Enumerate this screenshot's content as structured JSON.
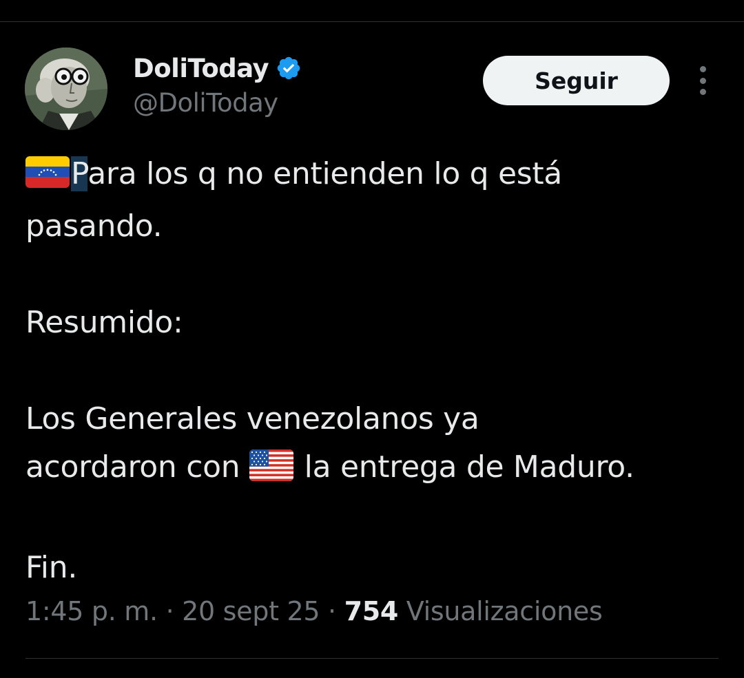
{
  "tweet": {
    "author": {
      "display_name": "DoliToday",
      "handle": "@DoliToday",
      "verified": true,
      "verified_color": "#1d9bf0"
    },
    "follow_label": "Seguir",
    "text": {
      "line1_flag": "venezuela-flag",
      "line1_first_char": "P",
      "line1_rest": "ara los q no entienden lo q está",
      "line2": "pasando.",
      "line3": "Resumido:",
      "line4": "Los Generales venezolanos ya",
      "line5_before": "acordaron con ",
      "line5_flag": "usa-flag",
      "line5_after": " la entrega de Maduro.",
      "line6": "Fin."
    },
    "meta": {
      "time": "1:45 p. m.",
      "separator": " · ",
      "date": "20 sept 25",
      "views_count": "754",
      "views_label": " Visualizaciones"
    }
  },
  "colors": {
    "background": "#000000",
    "text_primary": "#e7e9ea",
    "text_secondary": "#71767b",
    "divider": "#2f3336",
    "button_bg": "#eff3f4",
    "selection": "#173652"
  }
}
